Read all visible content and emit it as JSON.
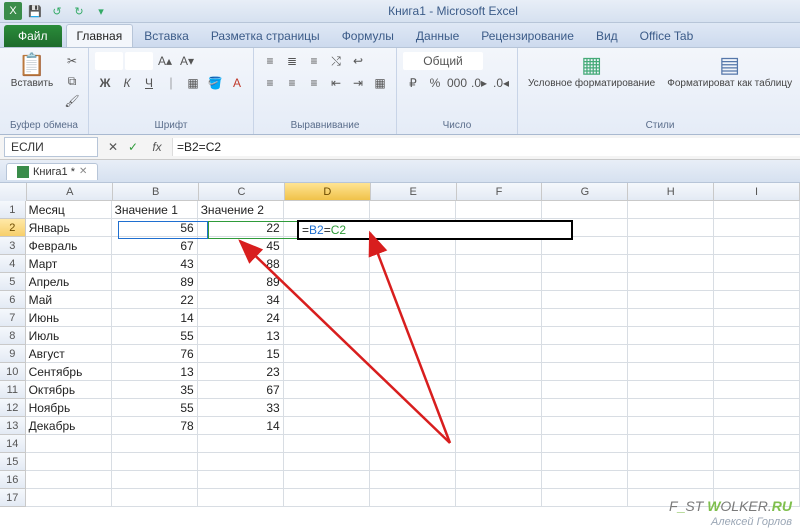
{
  "title": "Книга1 - Microsoft Excel",
  "qat": {
    "save": "💾",
    "undo": "↺",
    "redo": "↻"
  },
  "file_tab": "Файл",
  "tabs": [
    "Главная",
    "Вставка",
    "Разметка страницы",
    "Формулы",
    "Данные",
    "Рецензирование",
    "Вид",
    "Office Tab"
  ],
  "active_tab": 0,
  "ribbon": {
    "clipboard": {
      "paste": "Вставить",
      "label": "Буфер обмена"
    },
    "font": {
      "name": "",
      "size": "",
      "label": "Шрифт",
      "aa_up": "A",
      "aa_dn": "A",
      "b": "Ж",
      "i": "К",
      "u": "Ч"
    },
    "align": {
      "label": "Выравнивание"
    },
    "number": {
      "fmt": "Общий",
      "label": "Число"
    },
    "styles": {
      "cond": "Условное форматирование",
      "table": "Форматироват как таблицу",
      "label": "Стили"
    }
  },
  "namebox": "ЕСЛИ",
  "fx": {
    "cancel": "✕",
    "enter": "✓",
    "fx": "fx"
  },
  "formula": "=B2=C2",
  "wb_tab": "Книга1 *",
  "columns": [
    "A",
    "B",
    "C",
    "D",
    "E",
    "F",
    "G",
    "H",
    "I"
  ],
  "headers": {
    "A": "Месяц",
    "B": "Значение 1",
    "C": "Значение 2"
  },
  "rows": [
    {
      "A": "Январь",
      "B": 56,
      "C": 22
    },
    {
      "A": "Февраль",
      "B": 67,
      "C": 45
    },
    {
      "A": "Март",
      "B": 43,
      "C": 88
    },
    {
      "A": "Апрель",
      "B": 89,
      "C": 89
    },
    {
      "A": "Май",
      "B": 22,
      "C": 34
    },
    {
      "A": "Июнь",
      "B": 14,
      "C": 24
    },
    {
      "A": "Июль",
      "B": 55,
      "C": 13
    },
    {
      "A": "Август",
      "B": 76,
      "C": 15
    },
    {
      "A": "Сентябрь",
      "B": 13,
      "C": 23
    },
    {
      "A": "Октябрь",
      "B": 35,
      "C": 67
    },
    {
      "A": "Ноябрь",
      "B": 55,
      "C": 33
    },
    {
      "A": "Декабрь",
      "B": 78,
      "C": 14
    }
  ],
  "edit_cell": {
    "parts": [
      "=",
      "B2",
      "=",
      "C2"
    ]
  },
  "watermark": {
    "a": "F",
    "b": "_",
    "c": "ST",
    "d": "W",
    "e": "OLKER.",
    "f": "RU"
  },
  "credit": "Алексей Горлов"
}
